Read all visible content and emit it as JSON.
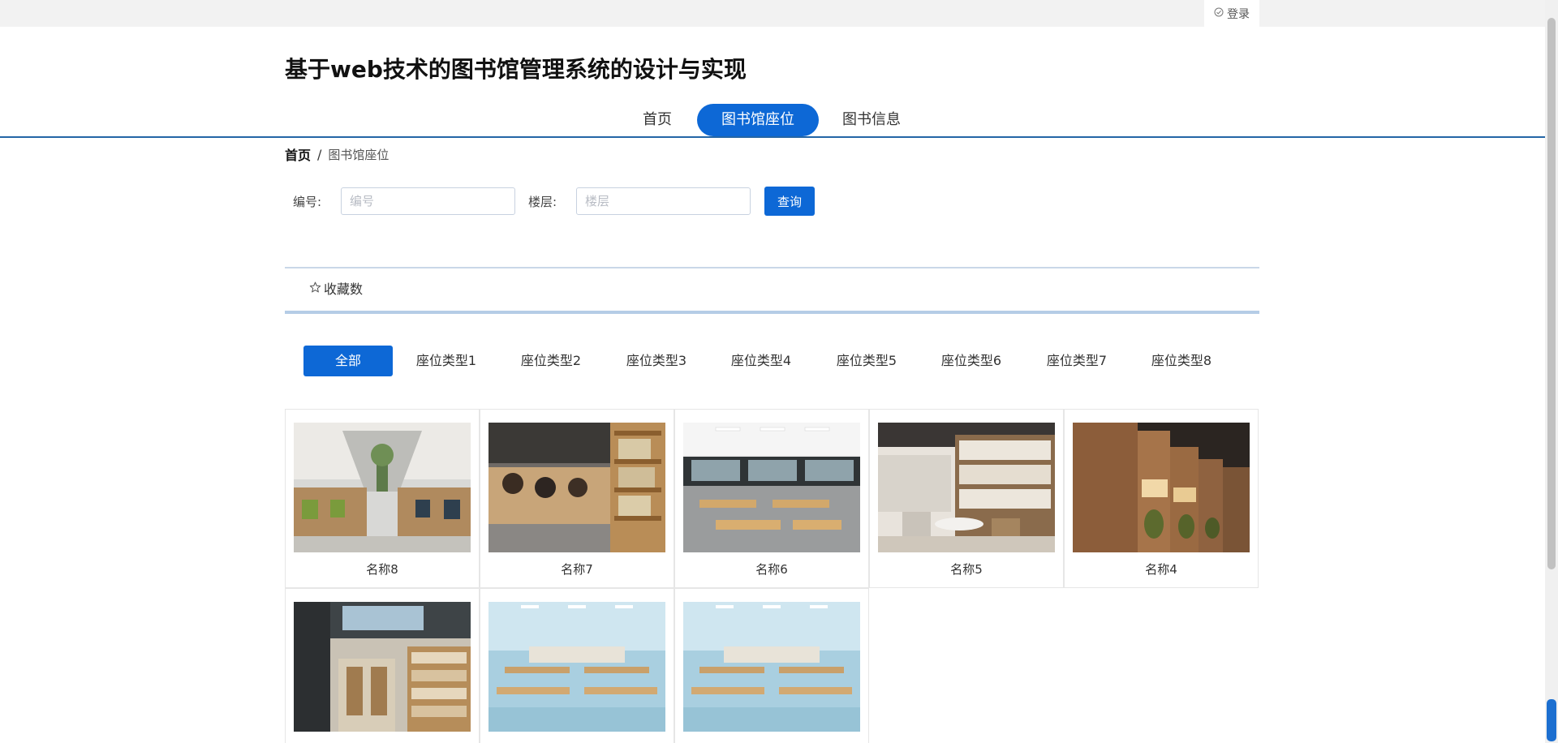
{
  "topbar": {
    "login_label": "登录"
  },
  "header": {
    "title": "基于web技术的图书馆管理系统的设计与实现"
  },
  "nav": {
    "items": [
      {
        "label": "首页",
        "active": false
      },
      {
        "label": "图书馆座位",
        "active": true
      },
      {
        "label": "图书信息",
        "active": false
      }
    ]
  },
  "breadcrumb": {
    "home": "首页",
    "separator": "/",
    "current": "图书馆座位"
  },
  "search": {
    "fields": [
      {
        "label": "编号:",
        "placeholder": "编号",
        "value": ""
      },
      {
        "label": "楼层:",
        "placeholder": "楼层",
        "value": ""
      }
    ],
    "button_label": "查询"
  },
  "sort": {
    "label": "收藏数",
    "icon": "star-outline-icon"
  },
  "categories": {
    "items": [
      {
        "label": "全部",
        "active": true
      },
      {
        "label": "座位类型1",
        "active": false
      },
      {
        "label": "座位类型2",
        "active": false
      },
      {
        "label": "座位类型3",
        "active": false
      },
      {
        "label": "座位类型4",
        "active": false
      },
      {
        "label": "座位类型5",
        "active": false
      },
      {
        "label": "座位类型6",
        "active": false
      },
      {
        "label": "座位类型7",
        "active": false
      },
      {
        "label": "座位类型8",
        "active": false
      }
    ]
  },
  "seats": {
    "items": [
      {
        "name": "名称8"
      },
      {
        "name": "名称7"
      },
      {
        "name": "名称6"
      },
      {
        "name": "名称5"
      },
      {
        "name": "名称4"
      },
      {
        "name": ""
      },
      {
        "name": ""
      },
      {
        "name": ""
      }
    ]
  },
  "colors": {
    "primary": "#0d68d6",
    "nav_line": "#2466a6",
    "topbar": "#f2f2f2"
  }
}
